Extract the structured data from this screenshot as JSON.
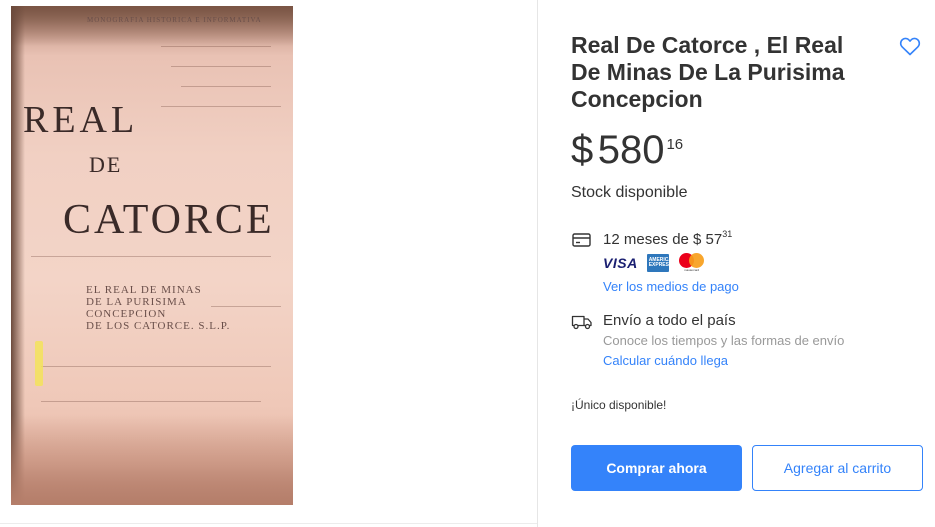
{
  "product": {
    "title": "Real De Catorce , El Real De Minas De La Purisima Concepcion",
    "price": {
      "symbol": "$",
      "integer": "580",
      "cents": "16"
    },
    "stock": "Stock disponible"
  },
  "gallery": {
    "image_text": {
      "line1": "REAL",
      "line2": "DE",
      "line3": "CATORCE",
      "small": [
        "EL REAL DE MINAS",
        "DE LA PURISIMA",
        "CONCEPCION",
        "DE LOS CATORCE. S.L.P."
      ],
      "header": "MONOGRAFIA HISTORICA E INFORMATIVA"
    }
  },
  "payment": {
    "installments_prefix": "12 meses de $ 57",
    "installments_cents": "31",
    "cards": [
      "VISA",
      "AMERICAN EXPRESS",
      "mastercard"
    ],
    "link": "Ver los medios de pago"
  },
  "shipping": {
    "title": "Envío a todo el país",
    "subtitle": "Conoce los tiempos y las formas de envío",
    "link": "Calcular cuándo llega"
  },
  "availability": "¡Único disponible!",
  "actions": {
    "buy": "Comprar ahora",
    "cart": "Agregar al carrito"
  },
  "colors": {
    "accent": "#3483fa",
    "text": "#333333",
    "muted": "#999999"
  }
}
